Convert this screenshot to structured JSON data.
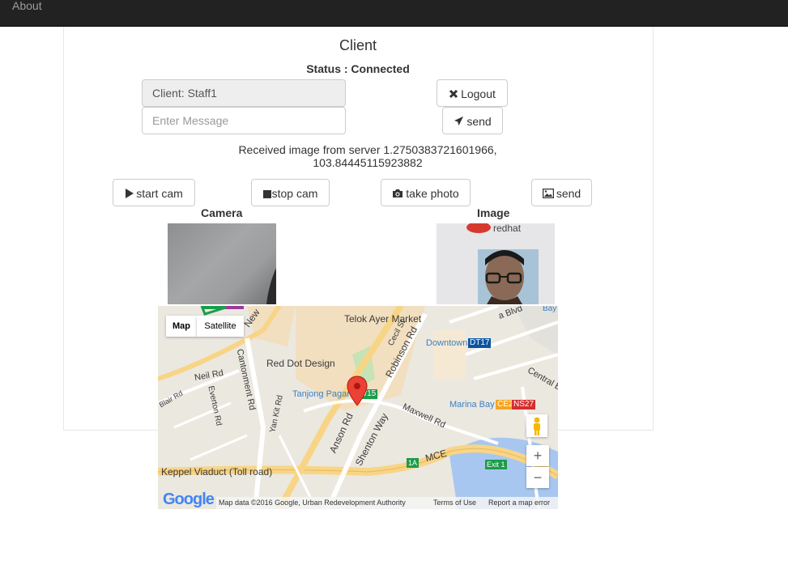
{
  "nav": {
    "about_label": "About"
  },
  "page": {
    "title": "Client",
    "status": "Status : Connected"
  },
  "client": {
    "name_value": "Client: Staff1",
    "message_placeholder": "Enter Message"
  },
  "buttons": {
    "logout": "Logout",
    "send_message": "send",
    "start_cam": "start cam",
    "stop_cam": "stop cam",
    "take_photo": "take photo",
    "send_image": "send"
  },
  "received": {
    "line1": "Received image from server 1.2750383721601966,",
    "line2": "103.84445115923882"
  },
  "panels": {
    "camera_label": "Camera",
    "image_label": "Image"
  },
  "map": {
    "type_map": "Map",
    "type_satellite": "Satellite",
    "labels": {
      "telok_ayer_market": "Telok Ayer Market",
      "red_dot_design": "Red Dot Design",
      "downtown": "Downtown",
      "downtown_code": "DT17",
      "neil_rd": "Neil Rd",
      "blair_rd": "Blair Rd",
      "everton_rd": "Everton Rd",
      "cantonment_rd": "Cantonment Rd",
      "yan_kit_rd": "Yan Kit Rd",
      "tanjong_pagar": "Tanjong Pagar",
      "tanjong_pagar_code": "EW15",
      "anson_rd": "Anson Rd",
      "shenton_way": "Shenton Way",
      "maxwell_rd": "Maxwell Rd",
      "robinson_rd": "Robinson Rd",
      "cecil_st": "Cecil St",
      "central_blvd": "Central Bl",
      "marina_bay": "Marina Bay",
      "marina_bay_code1": "CE2",
      "marina_bay_code2": "NS27",
      "keppel_viaduct": "Keppel Viaduct (Toll road)",
      "mce": "MCE",
      "exit_1a": "1A",
      "exit_1": "Exit 1",
      "new_bridge": "New",
      "bay": "Bay",
      "marina_blvd": "a Blvd"
    },
    "zoom_in": "+",
    "zoom_out": "−",
    "footer": {
      "data": "Map data ©2016 Google, Urban Redevelopment Authority",
      "terms": "Terms of Use",
      "report": "Report a map error"
    },
    "logo": "Google"
  },
  "colors": {
    "navbar": "#222222",
    "badge_green": "#1b9c4a",
    "badge_blue": "#0a55a0",
    "badge_orange": "#f5a623",
    "badge_red": "#d42e2e",
    "pin": "#ea4335"
  }
}
